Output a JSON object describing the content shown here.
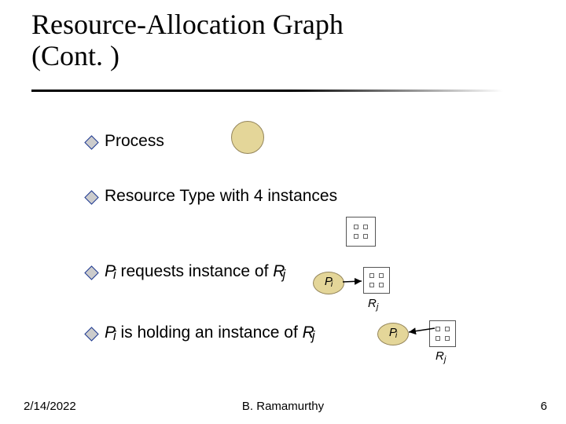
{
  "title_line1": "Resource-Allocation Graph",
  "title_line2": "(Cont. )",
  "bullets": {
    "process": "Process",
    "resource4": "Resource Type with 4 instances",
    "requests_pre": "P",
    "requests_sub1": "i",
    "requests_mid": " requests instance of ",
    "requests_R": "R",
    "requests_sub2": "j",
    "holding_pre": "P",
    "holding_sub1": "i",
    "holding_mid": " is holding an instance of ",
    "holding_R": "R",
    "holding_sub2": "j"
  },
  "labels": {
    "P": "P",
    "i": "i",
    "R": "R",
    "j": "j"
  },
  "footer": {
    "date": "2/14/2022",
    "author": "B. Ramamurthy",
    "page": "6"
  }
}
